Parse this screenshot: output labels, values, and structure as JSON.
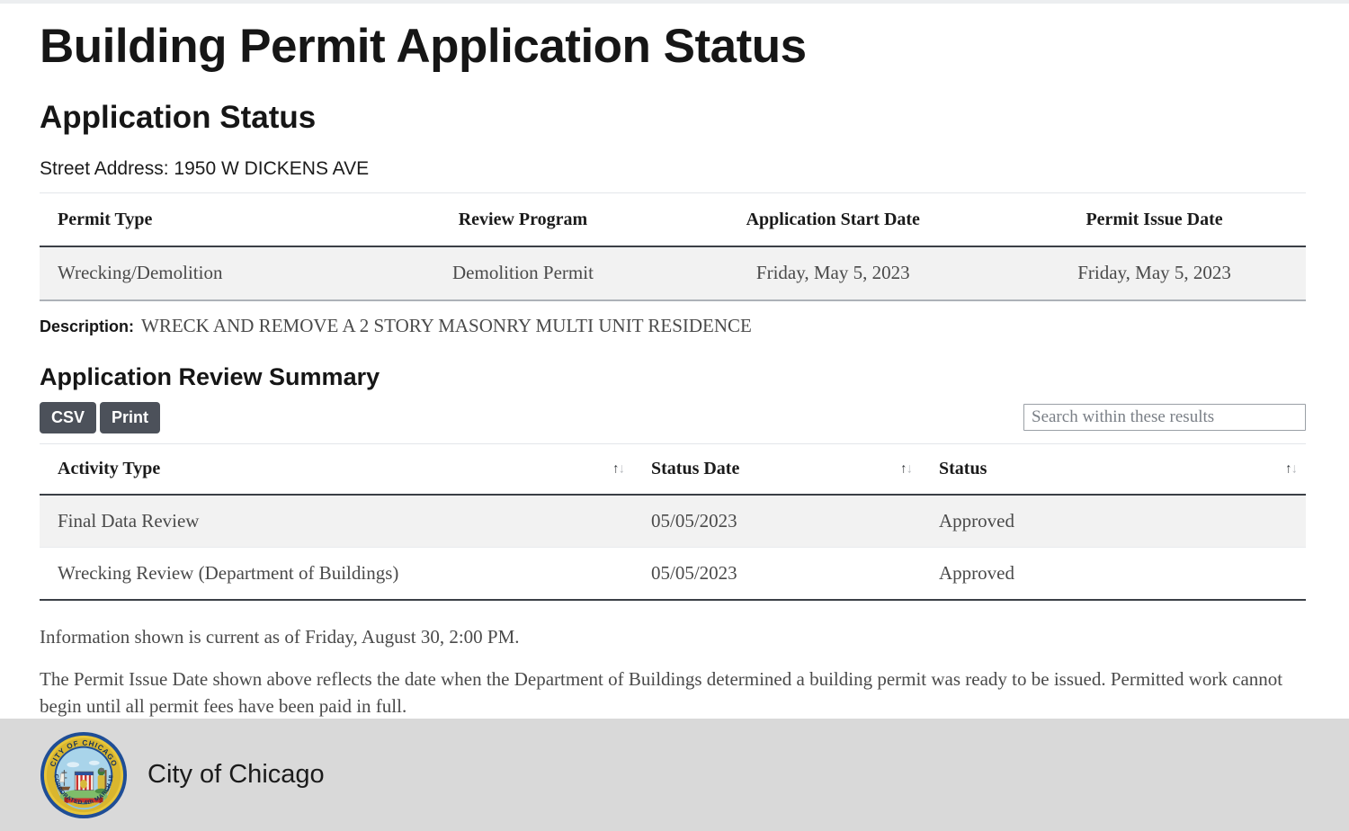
{
  "page": {
    "title": "Building Permit Application Status",
    "section_title": "Application Status",
    "street_address": "Street Address: 1950 W DICKENS AVE"
  },
  "permit_table": {
    "headers": [
      "Permit Type",
      "Review Program",
      "Application Start Date",
      "Permit Issue Date"
    ],
    "rows": [
      {
        "permit_type": "Wrecking/Demolition",
        "review_program": "Demolition Permit",
        "application_start_date": "Friday, May 5, 2023",
        "permit_issue_date": "Friday, May 5, 2023"
      }
    ]
  },
  "description": {
    "label": "Description:",
    "value": "WRECK AND REMOVE A 2 STORY MASONRY MULTI UNIT RESIDENCE"
  },
  "review_summary": {
    "title": "Application Review Summary",
    "toolbar": {
      "csv_label": "CSV",
      "print_label": "Print"
    },
    "search": {
      "value": "",
      "placeholder": "Search within these results"
    },
    "headers": [
      "Activity Type",
      "Status Date",
      "Status"
    ],
    "sort_icon": {
      "up": "↑",
      "down": "↓"
    },
    "rows": [
      {
        "activity_type": "Final Data Review",
        "status_date": "05/05/2023",
        "status": "Approved"
      },
      {
        "activity_type": "Wrecking Review (Department of Buildings)",
        "status_date": "05/05/2023",
        "status": "Approved"
      }
    ]
  },
  "notes": {
    "currency": "Information shown is current as of Friday, August 30, 2:00 PM.",
    "issue_date_note": "The Permit Issue Date shown above reflects the date when the Department of Buildings determined a building permit was ready to be issued. Permitted work cannot begin until all permit fees have been paid in full."
  },
  "footer": {
    "label": "City of Chicago",
    "seal": {
      "outer_ring_text_top": "CITY OF CHICAGO",
      "outer_ring_text_bottom": "INCORPORATED 4th MARCH 1837"
    }
  },
  "colors": {
    "button_bg": "#4c515a",
    "row_shade": "#f2f2f2",
    "footer_bg": "#d9d9d9",
    "header_rule": "#3b3f46",
    "seal_ring": "#1f4e96",
    "seal_gold": "#e8c63a"
  }
}
